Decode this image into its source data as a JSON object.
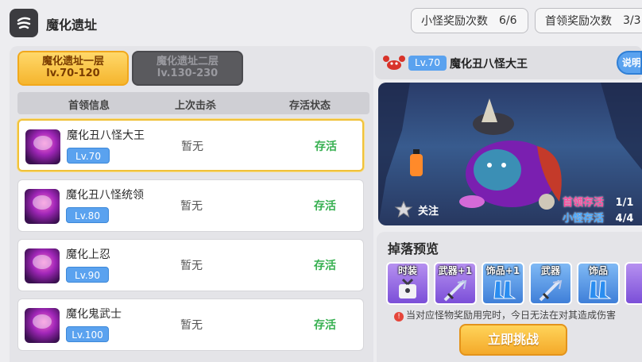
{
  "header": {
    "title": "魔化遗址",
    "minion_reward": {
      "label": "小怪奖励次数",
      "value": "6/6"
    },
    "boss_reward": {
      "label": "首领奖励次数",
      "value": "3/3"
    }
  },
  "tabs": [
    {
      "name": "魔化遗址一层",
      "range": "lv.70-120",
      "active": true
    },
    {
      "name": "魔化遗址二层",
      "range": "lv.130-230",
      "active": false
    }
  ],
  "table": {
    "headers": [
      "首领信息",
      "上次击杀",
      "存活状态"
    ],
    "rows": [
      {
        "name": "魔化丑八怪大王",
        "level": "Lv.70",
        "last_kill": "暂无",
        "status": "存活",
        "selected": true
      },
      {
        "name": "魔化丑八怪统领",
        "level": "Lv.80",
        "last_kill": "暂无",
        "status": "存活",
        "selected": false
      },
      {
        "name": "魔化上忍",
        "level": "Lv.90",
        "last_kill": "暂无",
        "status": "存活",
        "selected": false
      },
      {
        "name": "魔化鬼武士",
        "level": "Lv.100",
        "last_kill": "暂无",
        "status": "存活",
        "selected": false
      }
    ]
  },
  "detail": {
    "level": "Lv.70",
    "name": "魔化丑八怪大王",
    "help_label": "说明",
    "follow_label": "关注",
    "boss_alive_label": "首领存活",
    "boss_alive_value": "1/1",
    "minion_alive_label": "小怪存活",
    "minion_alive_value": "4/4"
  },
  "drops": {
    "title": "掉落预览",
    "items": [
      {
        "tag": "时装",
        "icon": "costume-icon",
        "color": "purple"
      },
      {
        "tag": "武器+1",
        "icon": "weapon-icon",
        "color": "purple"
      },
      {
        "tag": "饰品+1",
        "icon": "boots-icon",
        "color": "blue"
      },
      {
        "tag": "武器",
        "icon": "weapon-icon",
        "color": "blue"
      },
      {
        "tag": "饰品",
        "icon": "boots-icon",
        "color": "blue"
      }
    ],
    "notice": "当对应怪物奖励用完时，今日无法在对其造成伤害",
    "challenge_label": "立即挑战"
  },
  "colors": {
    "accent_gold": "#f5b52e",
    "level_blue": "#5aa2ef",
    "alive_green": "#36b050",
    "boss_alive_pink": "#ff4a9c",
    "minion_alive_blue": "#49a9ff"
  }
}
